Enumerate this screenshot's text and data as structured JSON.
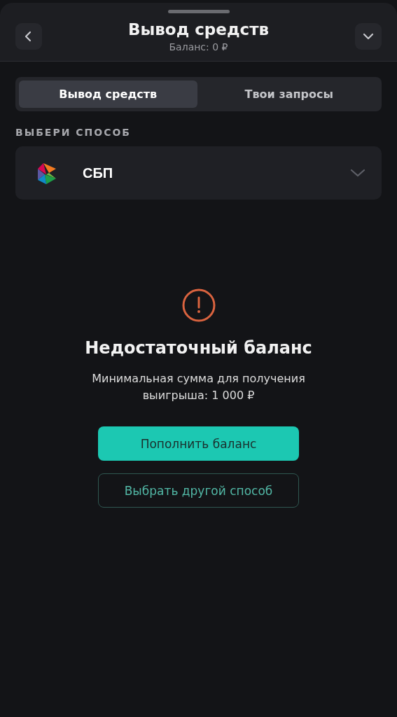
{
  "header": {
    "title": "Вывод средств",
    "subtitle": "Баланс: 0 ₽"
  },
  "tabs": [
    {
      "label": "Вывод средств",
      "selected": true
    },
    {
      "label": "Твои запросы",
      "selected": false
    }
  ],
  "method_section": {
    "label": "ВЫБЕРИ СПОСОБ",
    "selected_method": "СБП"
  },
  "notice": {
    "title": "Недостаточный баланс",
    "description": "Минимальная сумма для получения выигрыша: 1 000 ₽"
  },
  "buttons": [
    {
      "label": "Пополнить баланс",
      "kind": "primary"
    },
    {
      "label": "Выбрать другой способ",
      "kind": "outline"
    }
  ]
}
